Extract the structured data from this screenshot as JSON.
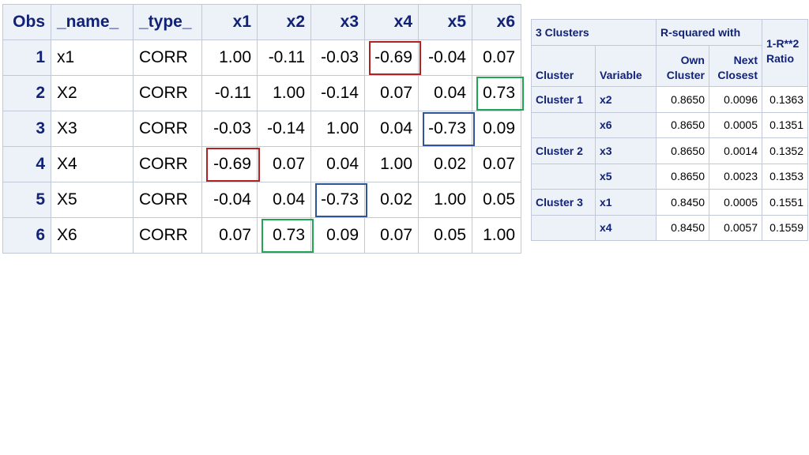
{
  "corr_table": {
    "headers": [
      "Obs",
      "_name_",
      "_type_",
      "x1",
      "x2",
      "x3",
      "x4",
      "x5",
      "x6"
    ],
    "rows": [
      {
        "obs": "1",
        "name": "x1",
        "type": "CORR",
        "values": [
          "1.00",
          "-0.11",
          "-0.03",
          "-0.69",
          "-0.04",
          "0.07"
        ]
      },
      {
        "obs": "2",
        "name": "X2",
        "type": "CORR",
        "values": [
          "-0.11",
          "1.00",
          "-0.14",
          "0.07",
          "0.04",
          "0.73"
        ]
      },
      {
        "obs": "3",
        "name": "X3",
        "type": "CORR",
        "values": [
          "-0.03",
          "-0.14",
          "1.00",
          "0.04",
          "-0.73",
          "0.09"
        ]
      },
      {
        "obs": "4",
        "name": "X4",
        "type": "CORR",
        "values": [
          "-0.69",
          "0.07",
          "0.04",
          "1.00",
          "0.02",
          "0.07"
        ]
      },
      {
        "obs": "5",
        "name": "X5",
        "type": "CORR",
        "values": [
          "-0.04",
          "0.04",
          "-0.73",
          "0.02",
          "1.00",
          "0.05"
        ]
      },
      {
        "obs": "6",
        "name": "X6",
        "type": "CORR",
        "values": [
          "0.07",
          "0.73",
          "0.09",
          "0.07",
          "0.05",
          "1.00"
        ]
      }
    ],
    "highlights": [
      {
        "row": 0,
        "col": 3,
        "color": "#b22222"
      },
      {
        "row": 3,
        "col": 0,
        "color": "#b22222"
      },
      {
        "row": 2,
        "col": 4,
        "color": "#2f5597"
      },
      {
        "row": 4,
        "col": 2,
        "color": "#2f5597"
      },
      {
        "row": 1,
        "col": 5,
        "color": "#22a552"
      },
      {
        "row": 5,
        "col": 1,
        "color": "#22a552"
      }
    ]
  },
  "cluster_table": {
    "title": "3 Clusters",
    "rsq_group": "R-squared with",
    "col_cluster": "Cluster",
    "col_variable": "Variable",
    "col_own": [
      "Own",
      "Cluster"
    ],
    "col_next": [
      "Next",
      "Closest"
    ],
    "col_ratio": [
      "1-R**2",
      "Ratio"
    ],
    "rows": [
      {
        "cluster": "Cluster 1",
        "variable": "x2",
        "own": "0.8650",
        "next": "0.0096",
        "ratio": "0.1363"
      },
      {
        "cluster": "",
        "variable": "x6",
        "own": "0.8650",
        "next": "0.0005",
        "ratio": "0.1351"
      },
      {
        "cluster": "Cluster 2",
        "variable": "x3",
        "own": "0.8650",
        "next": "0.0014",
        "ratio": "0.1352"
      },
      {
        "cluster": "",
        "variable": "x5",
        "own": "0.8650",
        "next": "0.0023",
        "ratio": "0.1353"
      },
      {
        "cluster": "Cluster 3",
        "variable": "x1",
        "own": "0.8450",
        "next": "0.0005",
        "ratio": "0.1551"
      },
      {
        "cluster": "",
        "variable": "x4",
        "own": "0.8450",
        "next": "0.0057",
        "ratio": "0.1559"
      }
    ]
  }
}
